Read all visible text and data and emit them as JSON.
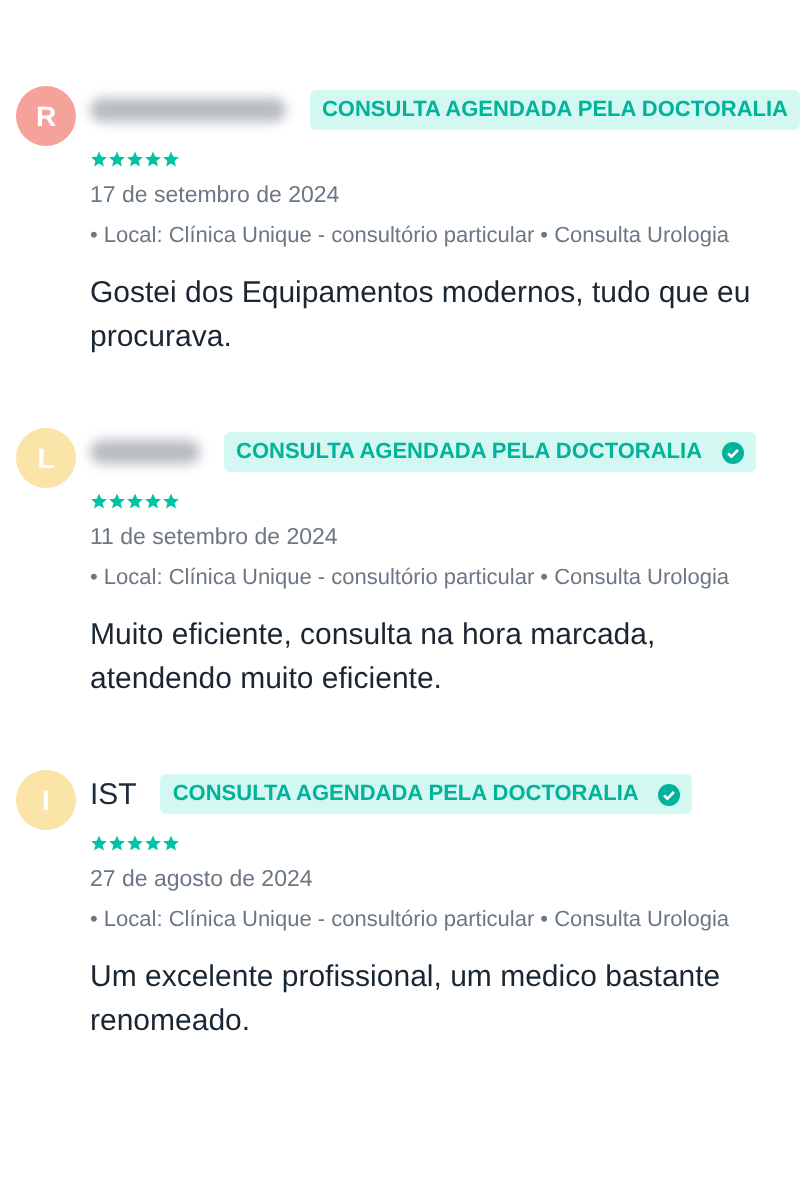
{
  "reviews": [
    {
      "avatar": "R",
      "color": "#f4a29a",
      "name_hidden": true,
      "badge": "CONSULTA AGENDADA PELA DOCTORALIA",
      "stars": 5,
      "date": "17 de setembro de 2024",
      "location": "• Local: Clínica Unique - consultório particular • Consulta Urologia",
      "text": "Gostei dos Equipamentos modernos, tudo que eu procurava."
    },
    {
      "avatar": "L",
      "color": "#fbe4a8",
      "name_hidden": true,
      "badge": "CONSULTA AGENDADA PELA DOCTORALIA",
      "verified_icon": true,
      "stars": 5,
      "date": "11 de setembro de 2024",
      "location": "• Local: Clínica Unique - consultório particular • Consulta Urologia",
      "text": "Muito eficiente, consulta na hora marcada, atendendo muito eficiente."
    },
    {
      "avatar": "I",
      "color": "#fbe4a8",
      "name": "IST",
      "name_hidden": false,
      "badge": "CONSULTA AGENDADA PELA DOCTORALIA",
      "verified_icon": true,
      "stars": 5,
      "date": "27 de agosto de 2024",
      "location": "• Local: Clínica Unique - consultório particular • Consulta Urologia",
      "text": "Um excelente profissional, um medico bastante renomeado."
    }
  ]
}
